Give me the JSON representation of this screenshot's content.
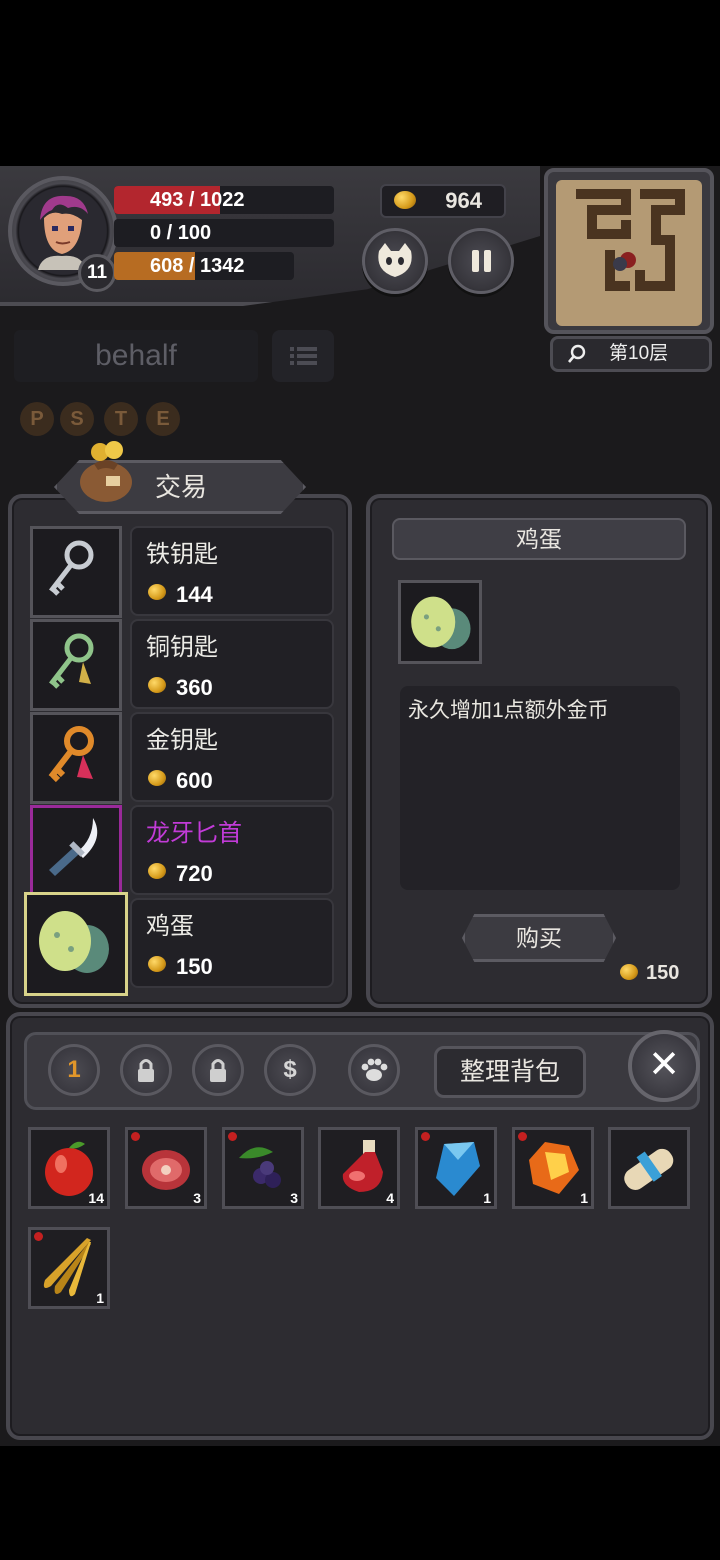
{
  "hud": {
    "hp": "493 / 1022",
    "hp_fraction": 0.48,
    "mp": "0 / 100",
    "mp_fraction": 0,
    "exp": "608 / 1342",
    "exp_fraction": 0.45,
    "level": "11",
    "gold": "964",
    "floor": "第10层"
  },
  "search_text": "behalf",
  "rune_letters": [
    "P",
    "S",
    "T",
    "E"
  ],
  "trade": {
    "title": "交易",
    "items": [
      {
        "name": "铁钥匙",
        "price": "144",
        "icon": "iron-key-icon"
      },
      {
        "name": "铜钥匙",
        "price": "360",
        "icon": "copper-key-icon"
      },
      {
        "name": "金钥匙",
        "price": "600",
        "icon": "gold-key-icon"
      },
      {
        "name": "龙牙匕首",
        "price": "720",
        "icon": "dragon-fang-dagger-icon"
      },
      {
        "name": "鸡蛋",
        "price": "150",
        "icon": "egg-icon"
      }
    ],
    "rare_color": "#c23bd8",
    "selected_color": "#d8d38a"
  },
  "detail": {
    "title": "鸡蛋",
    "description": "永久增加1点额外金币",
    "buy_label": "购买",
    "price": "150"
  },
  "inventory": {
    "tab_1_label": "1",
    "tab_gold_label": "$",
    "sort_label": "整理背包",
    "close_label": "✕",
    "slots": [
      {
        "icon": "apple-icon",
        "count": "14",
        "new": false
      },
      {
        "icon": "raw-meat-icon",
        "count": "3",
        "new": true
      },
      {
        "icon": "berries-icon",
        "count": "3",
        "new": true
      },
      {
        "icon": "red-potion-icon",
        "count": "4",
        "new": true
      },
      {
        "icon": "blue-crystal-icon",
        "count": "1",
        "new": true
      },
      {
        "icon": "orange-crystal-icon",
        "count": "1",
        "new": true
      },
      {
        "icon": "scroll-icon",
        "count": "",
        "new": false
      },
      {
        "icon": "golden-feathers-icon",
        "count": "1",
        "new": true
      }
    ]
  }
}
